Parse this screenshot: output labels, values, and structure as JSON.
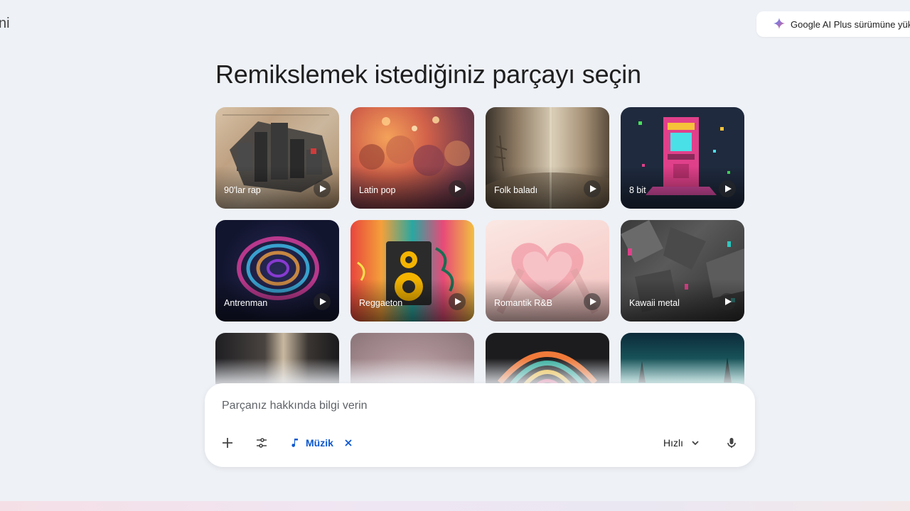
{
  "app": {
    "title_fragment": "ni"
  },
  "upgrade": {
    "label": "Google AI Plus sürümüne yük",
    "icon": "sparkle-icon"
  },
  "heading": "Remikslemek istediğiniz parçayı seçin",
  "cards": [
    {
      "label": "90'lar rap"
    },
    {
      "label": "Latin pop"
    },
    {
      "label": "Folk baladı"
    },
    {
      "label": "8 bit"
    },
    {
      "label": "Antrenman"
    },
    {
      "label": "Reggaeton"
    },
    {
      "label": "Romantik R&B"
    },
    {
      "label": "Kawaii metal"
    },
    {
      "label": ""
    },
    {
      "label": ""
    },
    {
      "label": ""
    },
    {
      "label": ""
    }
  ],
  "composer": {
    "placeholder": "Parçanız hakkında bilgi verin",
    "chip_label": "Müzik",
    "speed_label": "Hızlı",
    "icons": [
      "plus-icon",
      "tune-icon",
      "music-note-icon",
      "close-icon",
      "chevron-down-icon",
      "mic-icon"
    ]
  },
  "colors": {
    "accent": "#0b57d0",
    "background": "#eef1f6"
  }
}
